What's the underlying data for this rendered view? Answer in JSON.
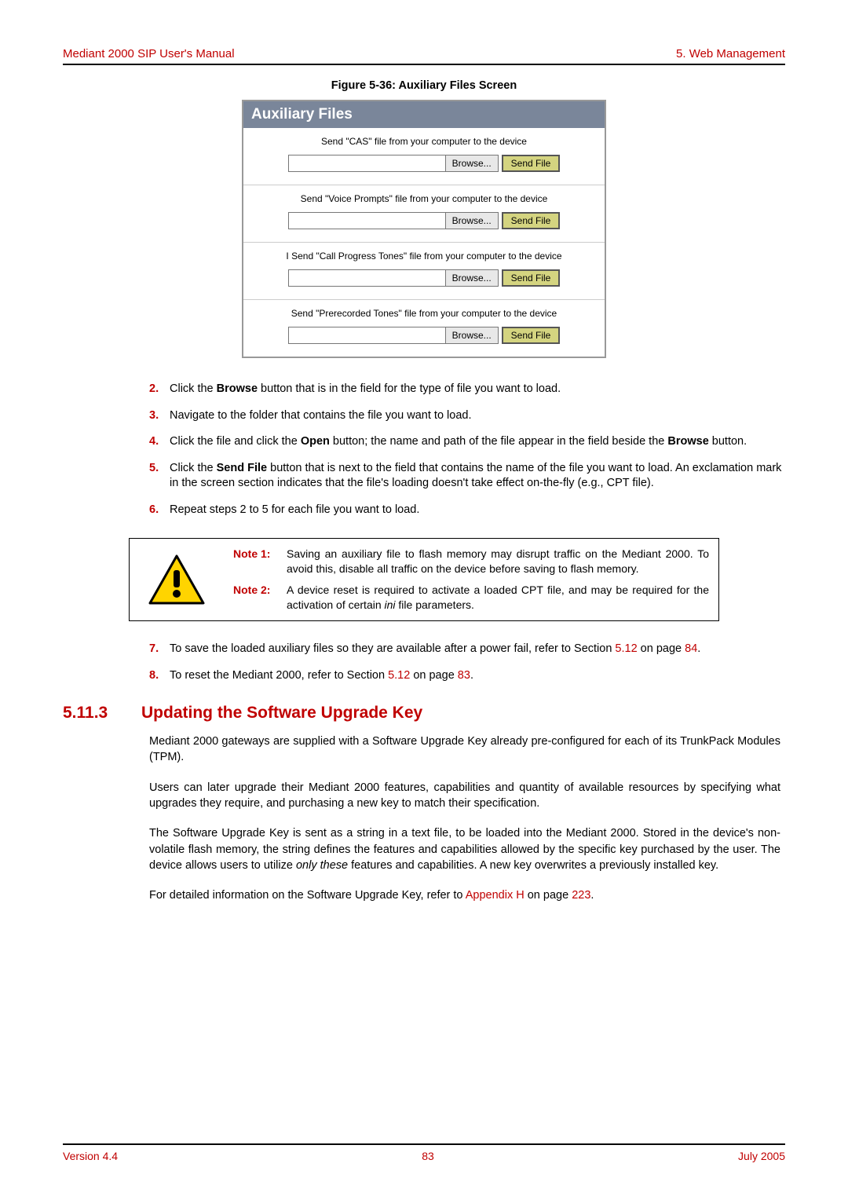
{
  "header": {
    "left": "Mediant 2000 SIP User's Manual",
    "right": "5. Web Management"
  },
  "figure": {
    "caption": "Figure 5-36: Auxiliary Files Screen",
    "panel_title": "Auxiliary Files",
    "sections": [
      {
        "label": "Send \"CAS\" file from your computer to the device",
        "browse": "Browse...",
        "send": "Send File"
      },
      {
        "label": "Send \"Voice Prompts\" file from your computer to the device",
        "browse": "Browse...",
        "send": "Send File"
      },
      {
        "label": "I Send \"Call Progress Tones\" file from your computer to the device",
        "browse": "Browse...",
        "send": "Send File"
      },
      {
        "label": "Send \"Prerecorded Tones\" file from your computer to the device",
        "browse": "Browse...",
        "send": "Send File"
      }
    ]
  },
  "steps_a": {
    "s2": {
      "num": "2.",
      "pre": "Click the ",
      "bold1": "Browse",
      "post": " button that is in the field for the type of file you want to load."
    },
    "s3": {
      "num": "3.",
      "text": "Navigate to the folder that contains the file you want to load."
    },
    "s4": {
      "num": "4.",
      "pre": "Click the file and click the ",
      "bold1": "Open",
      "mid": " button; the name and path of the file appear in the field beside the ",
      "bold2": "Browse",
      "post": " button."
    },
    "s5": {
      "num": "5.",
      "pre": "Click the ",
      "bold1": "Send File",
      "post": " button that is next to the field that contains the name of the file you want to load. An exclamation mark in the screen section indicates that the file's loading doesn't take effect on-the-fly (e.g., CPT file)."
    },
    "s6": {
      "num": "6.",
      "text": "Repeat steps 2 to 5 for each file you want to load."
    }
  },
  "notes": {
    "n1": {
      "label": "Note 1:",
      "text": "Saving an auxiliary file to flash memory may disrupt traffic on the Mediant 2000. To avoid this, disable all traffic on the device before saving to flash memory."
    },
    "n2": {
      "label": "Note 2:",
      "pre": "A device reset is required to activate a loaded CPT file, and may be required for the activation of certain ",
      "ital": "ini",
      "post": " file parameters."
    }
  },
  "steps_b": {
    "s7": {
      "num": "7.",
      "pre": "To save the loaded auxiliary files so they are available after a power fail, refer to Section ",
      "ref1": "5.12",
      "mid": " on page ",
      "ref2": "84",
      "post": "."
    },
    "s8": {
      "num": "8.",
      "pre": "To reset the Mediant 2000, refer to Section ",
      "ref1": "5.12",
      "mid": " on page ",
      "ref2": "83",
      "post": "."
    }
  },
  "section": {
    "num": "5.11.3",
    "title": "Updating the Software Upgrade Key"
  },
  "paras": {
    "p1": "Mediant 2000 gateways are supplied with a Software Upgrade Key already pre-configured for each of its TrunkPack Modules (TPM).",
    "p2": "Users can later upgrade their Mediant 2000 features, capabilities and quantity of available resources by specifying what upgrades they require, and purchasing a new key to match their specification.",
    "p3": {
      "pre": "The Software Upgrade Key is sent as a string in a text file, to be loaded into the Mediant 2000. Stored in the device's non-volatile flash memory, the string defines the features and capabilities allowed by the specific key purchased by the user. The device allows users to utilize ",
      "ital": "only these",
      "post": " features and capabilities. A new key overwrites a previously installed key."
    },
    "p4": {
      "pre": "For detailed information on the Software Upgrade Key, refer to ",
      "ref1": "Appendix H",
      "mid": " on page ",
      "ref2": "223",
      "post": "."
    }
  },
  "footer": {
    "left": "Version 4.4",
    "center": "83",
    "right": "July 2005"
  }
}
